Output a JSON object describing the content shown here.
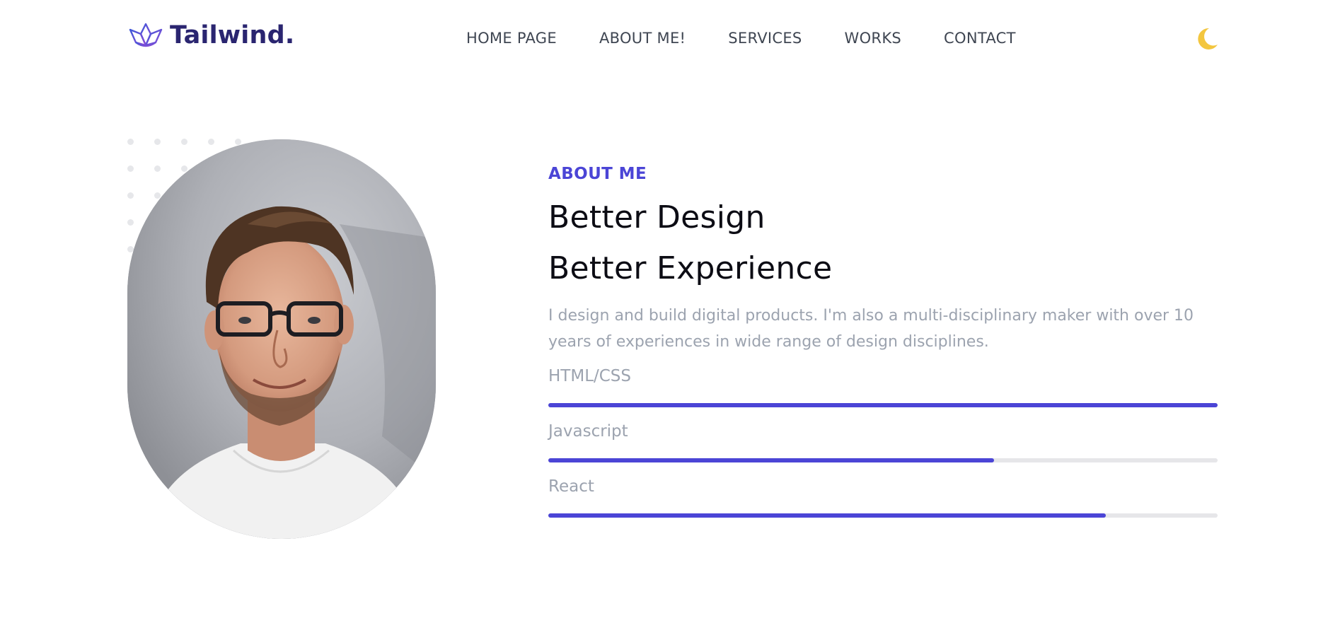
{
  "brand": {
    "name": "Tailwind.",
    "accent_color": "#4b45d6",
    "logo_icon": "crown-lotus-icon"
  },
  "nav": {
    "items": [
      {
        "label": "HOME PAGE"
      },
      {
        "label": "ABOUT ME!"
      },
      {
        "label": "SERVICES"
      },
      {
        "label": "WORKS"
      },
      {
        "label": "CONTACT"
      }
    ],
    "theme_toggle_icon": "moon-icon",
    "theme_toggle_color": "#f5c542"
  },
  "about": {
    "eyebrow": "ABOUT ME",
    "title_line_1": "Better Design",
    "title_line_2": "Better Experience",
    "description": "I design and build digital products. I'm also a multi-disciplinary maker with over 10 years of experiences in wide range of design disciplines.",
    "portrait_icon": "portrait-photo"
  },
  "skills": [
    {
      "label": "HTML/CSS",
      "level": 1.0
    },
    {
      "label": "Javascript",
      "level": 0.666
    },
    {
      "label": "React",
      "level": 0.833
    }
  ]
}
